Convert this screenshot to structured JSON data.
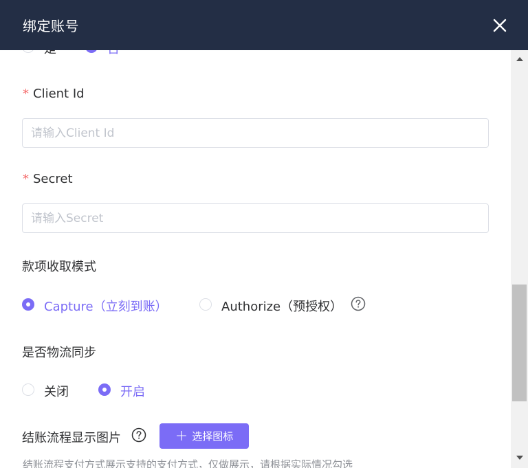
{
  "dialog": {
    "title": "绑定账号",
    "close_icon": "close-icon"
  },
  "top_partial": {
    "yes_label": "是",
    "no_label": "否",
    "selected": "否"
  },
  "client_id": {
    "required_mark": "*",
    "label": "Client Id",
    "value": "",
    "placeholder": "请输入Client Id"
  },
  "secret": {
    "required_mark": "*",
    "label": "Secret",
    "value": "",
    "placeholder": "请输入Secret"
  },
  "collection_mode": {
    "label": "款项收取模式",
    "options": [
      {
        "label": "Capture（立刻到账）",
        "checked": true
      },
      {
        "label": "Authorize（预授权）",
        "checked": false
      }
    ],
    "help_icon": "question-circle-icon"
  },
  "logistics_sync": {
    "label": "是否物流同步",
    "options": [
      {
        "label": "关闭",
        "checked": false
      },
      {
        "label": "开启",
        "checked": true
      }
    ]
  },
  "checkout_image": {
    "label": "结账流程显示图片",
    "help_icon": "question-circle-icon",
    "button_label": "选择图标",
    "button_icon": "plus-icon",
    "hint": "结账流程支付方式展示支持的支付方式，仅做展示，请根据实际情况勾选"
  },
  "colors": {
    "header_bg": "#232e45",
    "accent": "#7b6cf6",
    "required": "#f56c6c"
  }
}
